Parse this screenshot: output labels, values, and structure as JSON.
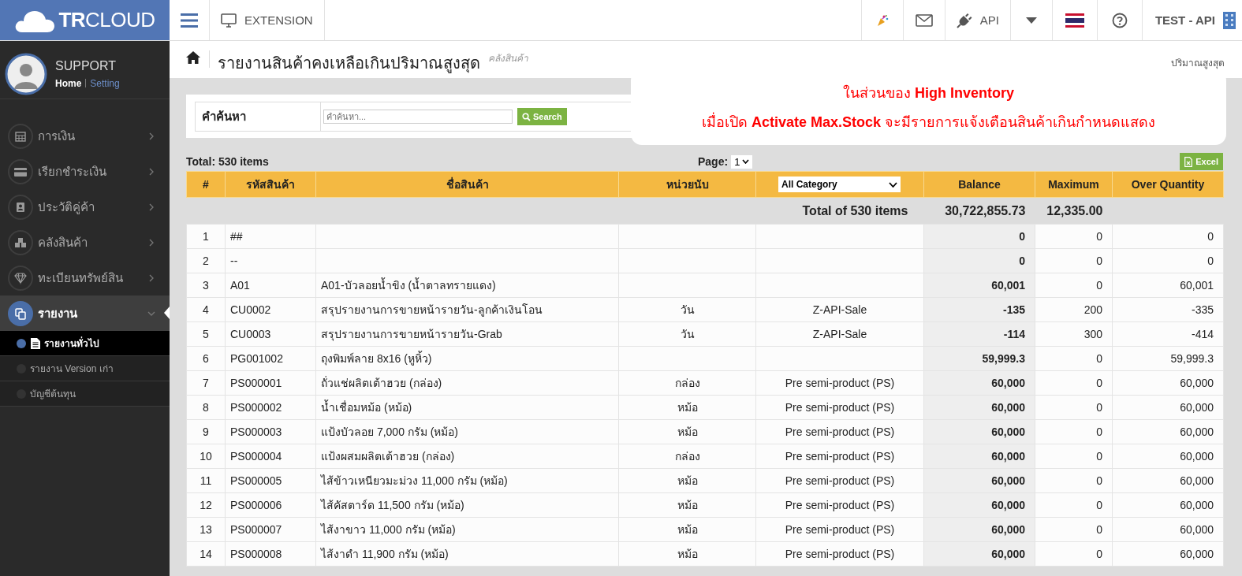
{
  "brand": {
    "name_bold": "TR",
    "name_rest": "CLOUD"
  },
  "topbar": {
    "extension": "EXTENSION",
    "api": "API",
    "account": "TEST - API"
  },
  "user": {
    "name": "SUPPORT",
    "home": "Home",
    "setting": "Setting"
  },
  "sidebar": {
    "items": [
      {
        "kind": "calendar",
        "label": "การเงิน",
        "selected": false,
        "expanded": false
      },
      {
        "kind": "card",
        "label": "เรียกชำระเงิน",
        "selected": false,
        "expanded": false
      },
      {
        "kind": "contact",
        "label": "ประวัติคู่ค้า",
        "selected": false,
        "expanded": false
      },
      {
        "kind": "boxes",
        "label": "คลังสินค้า",
        "selected": false,
        "expanded": false
      },
      {
        "kind": "diamond",
        "label": "ทะเบียนทรัพย์สิน",
        "selected": false,
        "expanded": false
      },
      {
        "kind": "copy",
        "label": "รายงาน",
        "selected": true,
        "expanded": true,
        "children": [
          {
            "label": "รายงานทั่วไป",
            "selected": true
          },
          {
            "label": "รายงาน Version เก่า",
            "selected": false
          },
          {
            "label": "บัญชีต้นทุน",
            "selected": false
          }
        ]
      }
    ]
  },
  "page": {
    "title": "รายงานสินค้าคงเหลือเกินปริมาณสูงสุด",
    "subtitle": "คลังสินค้า",
    "breadcrumb": "ปริมาณสูงสุด"
  },
  "callout": {
    "line_1": "ในส่วนของ **High Inventory**",
    "line_2": "เมื่อเปิด **Activate Max.Stock** จะมีรายการแจ้งเตือนสินค้าเกินกำหนดแสดง"
  },
  "search": {
    "label": "คำค้นหา",
    "placeholder": "คำค้นหา...",
    "button": "Search"
  },
  "summary": {
    "total": "Total: 530 items",
    "page_label": "Page:",
    "page_value": "1",
    "excel": "Excel"
  },
  "table": {
    "columns": [
      "#",
      "รหัสสินค้า",
      "ชื่อสินค้า",
      "หน่วยนับ",
      "All Category",
      "Balance",
      "Maximum",
      "Over Quantity"
    ],
    "total_row": {
      "label": "Total of 530 items",
      "balance": "30,722,855.73",
      "maximum": "12,335.00"
    },
    "rows": [
      [
        "1",
        "##",
        "",
        "",
        "",
        "0",
        "0",
        "0"
      ],
      [
        "2",
        "--",
        "",
        "",
        "",
        "0",
        "0",
        "0"
      ],
      [
        "3",
        "A01",
        "A01-บัวลอยน้ำขิง (น้ำตาลทรายแดง)",
        "",
        "",
        "60,001",
        "0",
        "60,001"
      ],
      [
        "4",
        "CU0002",
        "สรุปรายงานการขายหน้ารายวัน-ลูกค้าเงินโอน",
        "วัน",
        "Z-API-Sale",
        "-135",
        "200",
        "-335"
      ],
      [
        "5",
        "CU0003",
        "สรุปรายงานการขายหน้ารายวัน-Grab",
        "วัน",
        "Z-API-Sale",
        "-114",
        "300",
        "-414"
      ],
      [
        "6",
        "PG001002",
        "ถุงพิมพ์ลาย 8x16 (หูหิ้ว)",
        "",
        "",
        "59,999.3",
        "0",
        "59,999.3"
      ],
      [
        "7",
        "PS000001",
        "ถั่วแช่ผลิตเต้าฮวย (กล่อง)",
        "กล่อง",
        "Pre semi-product (PS)",
        "60,000",
        "0",
        "60,000"
      ],
      [
        "8",
        "PS000002",
        "น้ำเชื่อมหม้อ (หม้อ)",
        "หม้อ",
        "Pre semi-product (PS)",
        "60,000",
        "0",
        "60,000"
      ],
      [
        "9",
        "PS000003",
        "แป้งบัวลอย 7,000 กรัม (หม้อ)",
        "หม้อ",
        "Pre semi-product (PS)",
        "60,000",
        "0",
        "60,000"
      ],
      [
        "10",
        "PS000004",
        "แป้งผสมผลิตเต้าฮวย (กล่อง)",
        "กล่อง",
        "Pre semi-product (PS)",
        "60,000",
        "0",
        "60,000"
      ],
      [
        "11",
        "PS000005",
        "ไส้ข้าวเหนียวมะม่วง 11,000 กรัม (หม้อ)",
        "หม้อ",
        "Pre semi-product (PS)",
        "60,000",
        "0",
        "60,000"
      ],
      [
        "12",
        "PS000006",
        "ไส้คัสตาร์ด 11,500 กรัม (หม้อ)",
        "หม้อ",
        "Pre semi-product (PS)",
        "60,000",
        "0",
        "60,000"
      ],
      [
        "13",
        "PS000007",
        "ไส้งาขาว 11,000 กรัม (หม้อ)",
        "หม้อ",
        "Pre semi-product (PS)",
        "60,000",
        "0",
        "60,000"
      ],
      [
        "14",
        "PS000008",
        "ไส้งาดำ 11,900 กรัม (หม้อ)",
        "หม้อ",
        "Pre semi-product (PS)",
        "60,000",
        "0",
        "60,000"
      ]
    ]
  }
}
